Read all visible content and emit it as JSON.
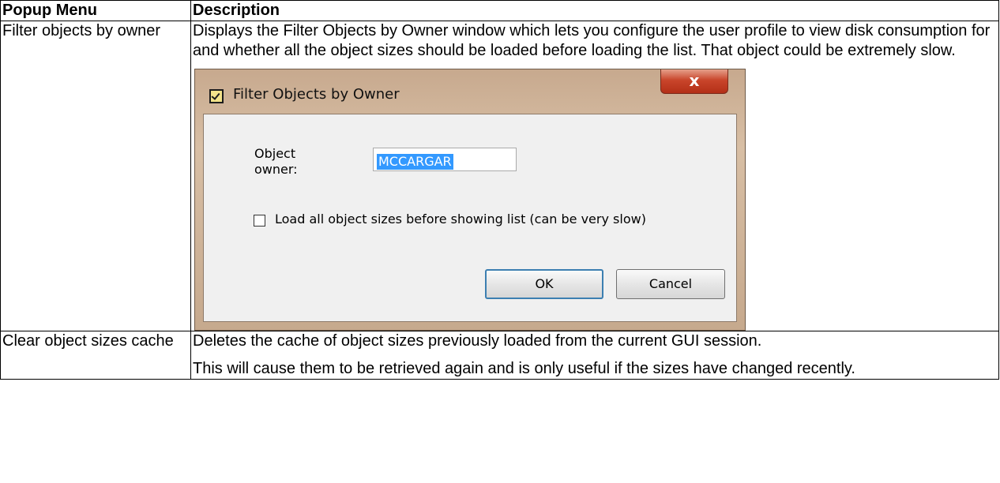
{
  "table": {
    "headers": [
      "Popup Menu",
      "Description"
    ],
    "rows": [
      {
        "menu": "Filter objects by owner",
        "description": [
          "Displays the Filter Objects by Owner window which lets you configure the user profile to view disk consumption for and whether all the object sizes should be loaded before loading the list.  That object could be extremely slow."
        ]
      },
      {
        "menu": "Clear object sizes cache",
        "description": [
          "Deletes the cache of object sizes previously loaded from the current GUI session.",
          "This will cause them to be retrieved again and is only useful if the sizes have changed recently."
        ]
      }
    ]
  },
  "dialog": {
    "title": "Filter Objects by Owner",
    "close_glyph": "x",
    "owner_label": "Object owner:",
    "owner_value": "MCCARGAR",
    "checkbox_label": "Load all object sizes before showing list (can be very slow)",
    "checkbox_checked": false,
    "ok_label": "OK",
    "cancel_label": "Cancel"
  }
}
